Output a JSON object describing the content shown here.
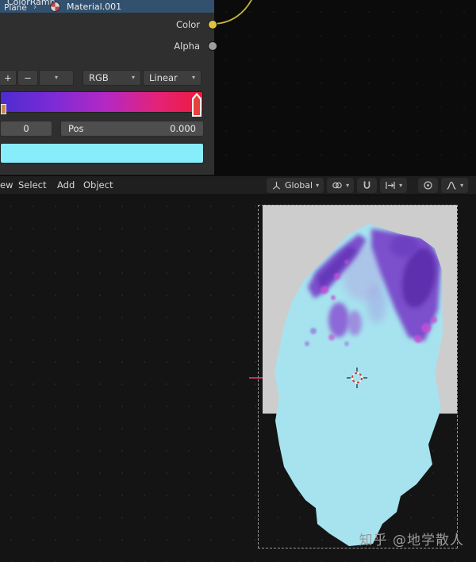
{
  "colors": {
    "socket_color_output": "#e2c23c",
    "socket_alpha_output": "#9e9e9e",
    "material_header_bar": "#31516f",
    "ramp_gradient_left": "#4c2cd0",
    "ramp_gradient_mid": "#b428c4",
    "ramp_gradient_right": "#ee1b3a",
    "color_swatch": "#88edfb",
    "map_land": "#a6e3ef",
    "map_mountains": "#7b50cc",
    "x_axis_line": "#bb3a50"
  },
  "icons": {
    "chevron_down": "▾",
    "breadcrumb_sep": "›"
  },
  "node_editor": {
    "node_title": "ColorRamp",
    "breadcrumb": {
      "object": "Plane",
      "material": "Material.001"
    },
    "outputs": [
      {
        "label": "Color"
      },
      {
        "label": "Alpha"
      }
    ],
    "controls": {
      "add": "+",
      "remove": "−",
      "color_mode": "RGB",
      "interpolation": "Linear",
      "index": "0",
      "pos_label": "Pos",
      "pos_value": "0.000"
    }
  },
  "viewport": {
    "menus": [
      "ew",
      "Select",
      "Add",
      "Object"
    ],
    "orientation": "Global"
  },
  "watermark": "知乎 @地学散人"
}
